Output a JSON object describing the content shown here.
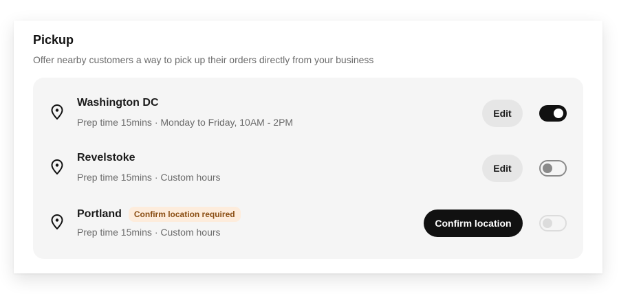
{
  "section": {
    "title": "Pickup",
    "subtitle": "Offer nearby customers a way to pick up their orders directly from your business"
  },
  "locations": [
    {
      "name": "Washington DC",
      "detail": "Prep time 15mins · Monday to Friday, 10AM - 2PM",
      "action_label": "Edit",
      "toggle_state": "on"
    },
    {
      "name": "Revelstoke",
      "detail": "Prep time 15mins · Custom hours",
      "action_label": "Edit",
      "toggle_state": "off"
    },
    {
      "name": "Portland",
      "badge": "Confirm location required",
      "detail": "Prep time 15mins · Custom hours",
      "action_label": "Confirm location",
      "toggle_state": "disabled"
    }
  ],
  "icons": {
    "location": "map-pin-icon"
  },
  "colors": {
    "primary": "#111111",
    "panel_bg": "#f5f5f5",
    "badge_bg": "#fdecdc",
    "badge_text": "#8a4d12",
    "muted_text": "#6b6b6b"
  }
}
